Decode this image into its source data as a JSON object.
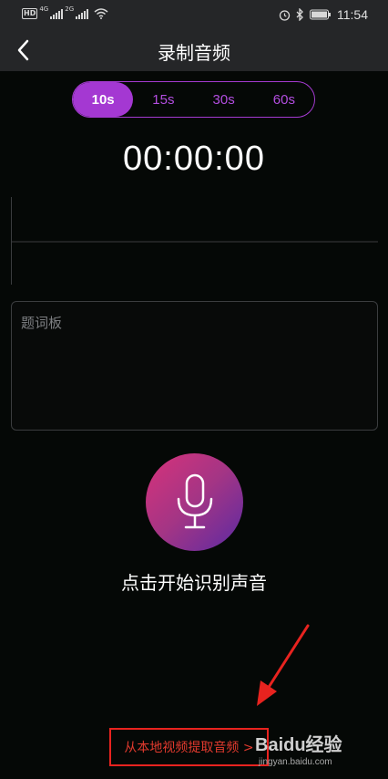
{
  "status_bar": {
    "hd": "HD",
    "net1": "4G",
    "net2": "2G",
    "time": "11:54"
  },
  "header": {
    "title": "录制音频"
  },
  "duration_options": [
    {
      "label": "10s",
      "selected": true
    },
    {
      "label": "15s",
      "selected": false
    },
    {
      "label": "30s",
      "selected": false
    },
    {
      "label": "60s",
      "selected": false
    }
  ],
  "timer": "00:00:00",
  "prompter": {
    "placeholder": "题词板"
  },
  "record": {
    "label": "点击开始识别声音"
  },
  "extract_link": {
    "label": "从本地视频提取音频 >"
  },
  "watermark": {
    "logo": "Baidu经验",
    "sub": "jingyan.baidu.com"
  },
  "colors": {
    "accent": "#a438d2",
    "annotation": "#e8231f",
    "header_bg": "#252628",
    "page_bg": "#050806"
  }
}
